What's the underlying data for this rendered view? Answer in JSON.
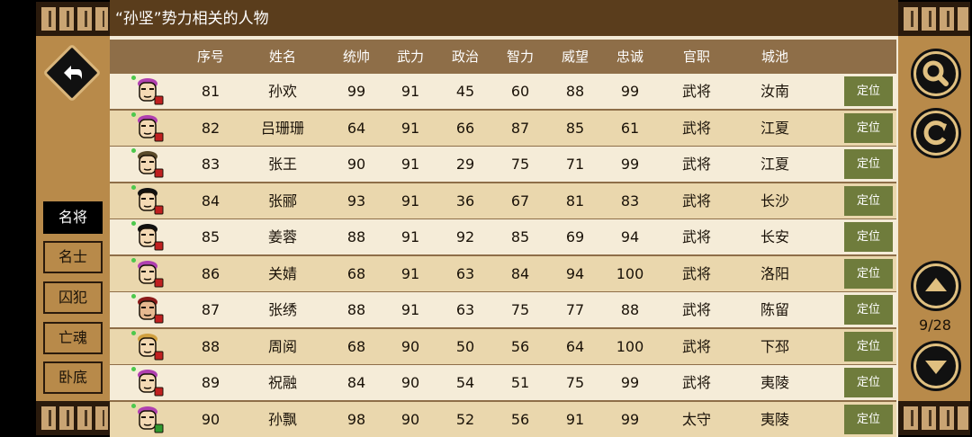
{
  "title": "“孙坚”势力相关的人物",
  "columns": [
    "序号",
    "姓名",
    "统帅",
    "武力",
    "政治",
    "智力",
    "威望",
    "忠诚",
    "官职",
    "城池"
  ],
  "rows": [
    {
      "no": "81",
      "name": "孙欢",
      "cmd": "99",
      "war": "91",
      "pol": "45",
      "int": "60",
      "fame": "88",
      "loyal": "99",
      "rank": "武将",
      "city": "汝南",
      "face": "#f4d9b4",
      "hair": "#b040b0",
      "badge": "red"
    },
    {
      "no": "82",
      "name": "吕珊珊",
      "cmd": "64",
      "war": "91",
      "pol": "66",
      "int": "87",
      "fame": "85",
      "loyal": "61",
      "rank": "武将",
      "city": "江夏",
      "face": "#f4d9b4",
      "hair": "#b040b0",
      "badge": "red"
    },
    {
      "no": "83",
      "name": "张王",
      "cmd": "90",
      "war": "91",
      "pol": "29",
      "int": "75",
      "fame": "71",
      "loyal": "99",
      "rank": "武将",
      "city": "江夏",
      "face": "#f4d9b4",
      "hair": "#5a4a2a",
      "badge": "red"
    },
    {
      "no": "84",
      "name": "张郦",
      "cmd": "93",
      "war": "91",
      "pol": "36",
      "int": "67",
      "fame": "81",
      "loyal": "83",
      "rank": "武将",
      "city": "长沙",
      "face": "#f4d9b4",
      "hair": "#111111",
      "badge": "red"
    },
    {
      "no": "85",
      "name": "姜蓉",
      "cmd": "88",
      "war": "91",
      "pol": "92",
      "int": "85",
      "fame": "69",
      "loyal": "94",
      "rank": "武将",
      "city": "长安",
      "face": "#f4d9b4",
      "hair": "#111111",
      "badge": "red"
    },
    {
      "no": "86",
      "name": "关婧",
      "cmd": "68",
      "war": "91",
      "pol": "63",
      "int": "84",
      "fame": "94",
      "loyal": "100",
      "rank": "武将",
      "city": "洛阳",
      "face": "#f4d9b4",
      "hair": "#b040b0",
      "badge": "red"
    },
    {
      "no": "87",
      "name": "张绣",
      "cmd": "88",
      "war": "91",
      "pol": "63",
      "int": "75",
      "fame": "77",
      "loyal": "88",
      "rank": "武将",
      "city": "陈留",
      "face": "#e6b890",
      "hair": "#8a1a1a",
      "badge": "red"
    },
    {
      "no": "88",
      "name": "周阅",
      "cmd": "68",
      "war": "90",
      "pol": "50",
      "int": "56",
      "fame": "64",
      "loyal": "100",
      "rank": "武将",
      "city": "下邳",
      "face": "#f4d9b4",
      "hair": "#d0a040",
      "badge": "red"
    },
    {
      "no": "89",
      "name": "祝融",
      "cmd": "84",
      "war": "90",
      "pol": "54",
      "int": "51",
      "fame": "75",
      "loyal": "99",
      "rank": "武将",
      "city": "夷陵",
      "face": "#f4d9b4",
      "hair": "#b040b0",
      "badge": "red"
    },
    {
      "no": "90",
      "name": "孙飘",
      "cmd": "98",
      "war": "90",
      "pol": "52",
      "int": "56",
      "fame": "91",
      "loyal": "99",
      "rank": "太守",
      "city": "夷陵",
      "face": "#f4d9b4",
      "hair": "#b040b0",
      "badge": "green"
    }
  ],
  "locate_label": "定位",
  "side_tabs": [
    {
      "label": "名将",
      "active": true
    },
    {
      "label": "名士",
      "active": false
    },
    {
      "label": "囚犯",
      "active": false
    },
    {
      "label": "亡魂",
      "active": false
    },
    {
      "label": "卧底",
      "active": false
    }
  ],
  "page_indicator": "9/28",
  "icons": {
    "back": "back-arrow-icon",
    "search": "search-icon",
    "refresh": "refresh-icon",
    "up": "up-arrow-icon",
    "down": "down-arrow-icon"
  }
}
